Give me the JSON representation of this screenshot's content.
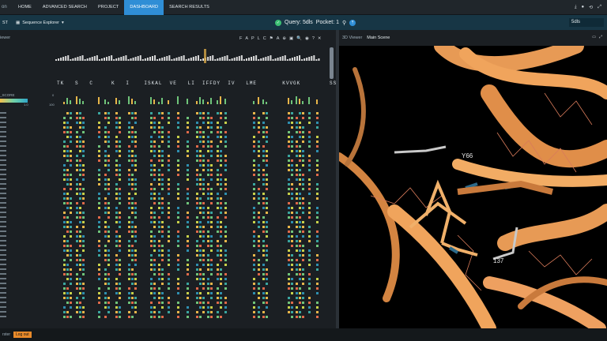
{
  "nav": {
    "brand": "on",
    "links": [
      "HOME",
      "ADVANCED SEARCH",
      "PROJECT",
      "DASHBOARD",
      "SEARCH RESULTS"
    ],
    "active_index": 3,
    "right_icons": [
      "download-icon",
      "person-icon",
      "share-icon",
      "expand-icon"
    ]
  },
  "subbar": {
    "left_label": "ST",
    "seq_label": "Sequence Explorer",
    "query_label": "Query: 5dls",
    "pocket_label": "Pocket: 1",
    "search_value": "5dls"
  },
  "left": {
    "pane_title": "iewer",
    "tool_glyphs": [
      "F",
      "A",
      "P",
      "L",
      "C",
      "⚑",
      "A",
      "⊕",
      "▣",
      "🔍",
      "◉",
      "?",
      "✕"
    ],
    "residue_header": "TK   S   C     K   I    ISKAL  VE   LI  IFFDY  IV   LME       KVVGK        SSQE   T    H    I",
    "score_label": "_SCORE",
    "grad_min": "1.0",
    "grad_zero": "0",
    "grad_max": "100"
  },
  "right": {
    "pane_title": "3D Viewer",
    "scene_label": "Main Scene",
    "label_y66": "Y66",
    "label_137": "137"
  },
  "status": {
    "prefix": "rster",
    "logout_label": "Log out"
  },
  "colors": {
    "accent": "#2f8ed6",
    "ribbon": "#f0a45c",
    "sel": "#3cbf73"
  }
}
